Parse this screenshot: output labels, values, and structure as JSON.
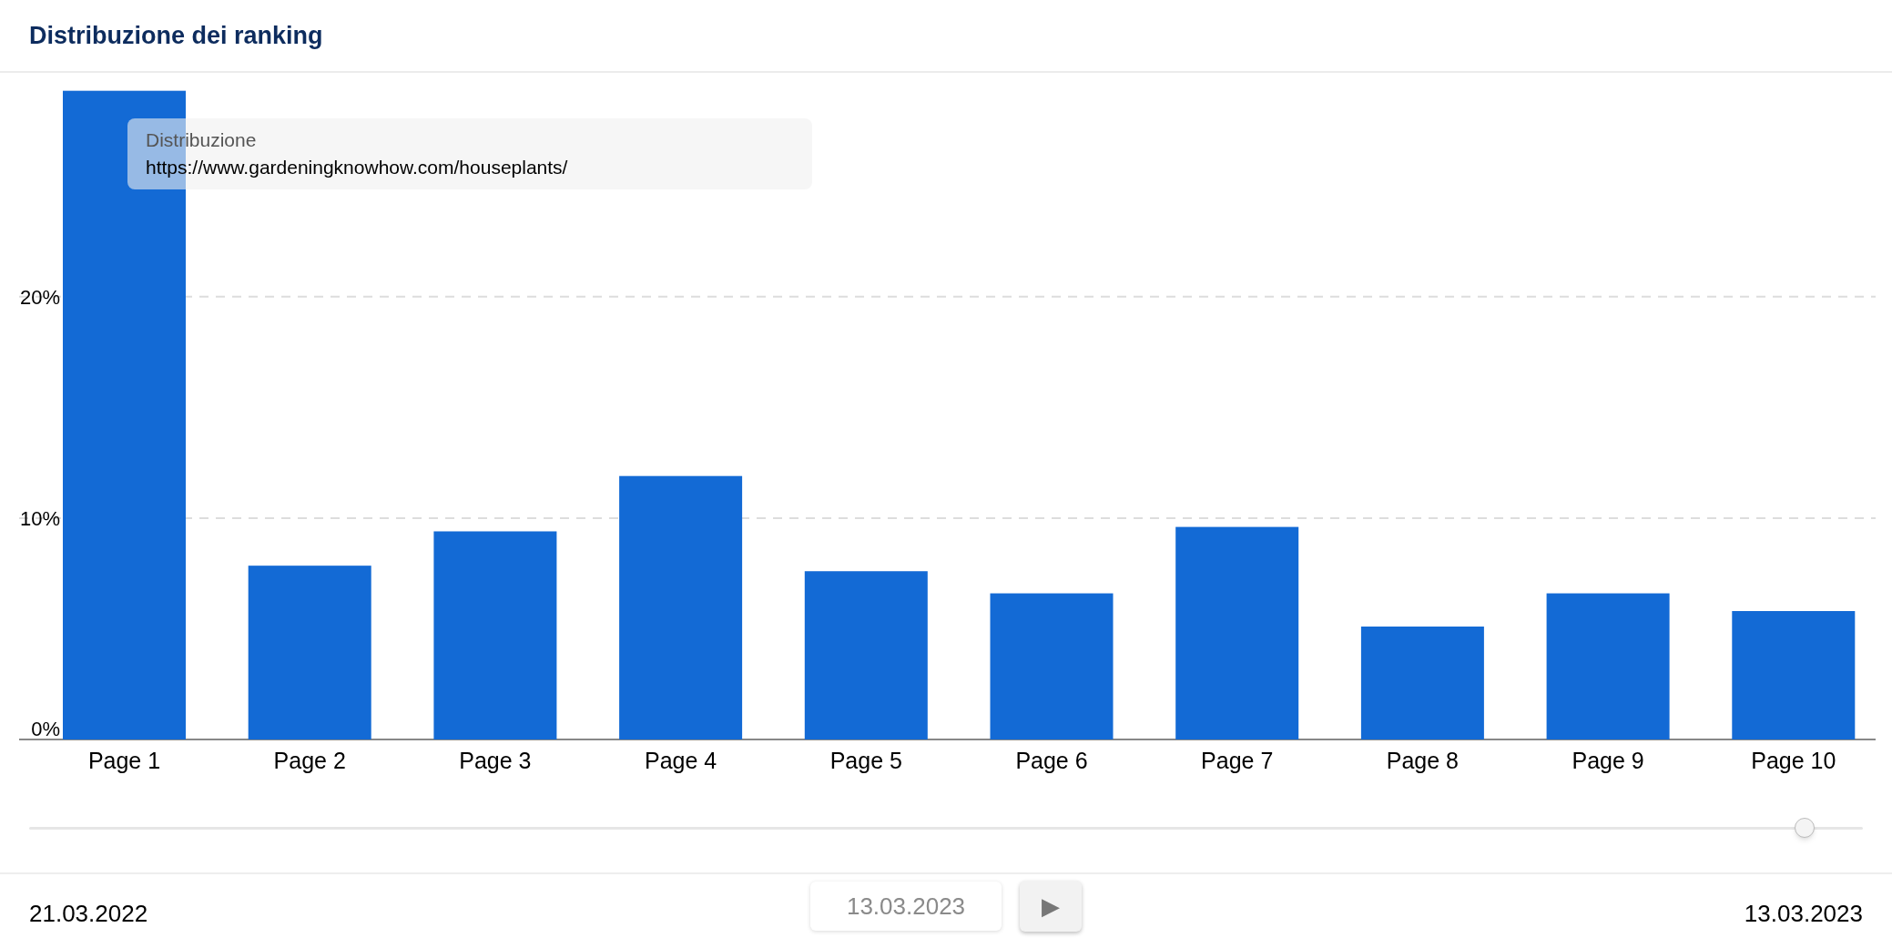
{
  "card": {
    "title": "Distribuzione dei ranking"
  },
  "chart_data": {
    "type": "bar",
    "categories": [
      "Page 1",
      "Page 2",
      "Page 3",
      "Page 4",
      "Page 5",
      "Page 6",
      "Page 7",
      "Page 8",
      "Page 9",
      "Page 10"
    ],
    "series": [
      {
        "name": "Distribuzione",
        "color": "#136ad5",
        "values": [
          29.3,
          7.85,
          9.4,
          11.9,
          7.6,
          6.6,
          9.6,
          5.1,
          6.6,
          5.8
        ]
      }
    ],
    "ylim": [
      0,
      33.4
    ],
    "yticks": [
      {
        "value": 0,
        "label": "0%"
      },
      {
        "value": 10,
        "label": "10%"
      },
      {
        "value": 20,
        "label": "20%"
      }
    ]
  },
  "tooltip": {
    "text": "https://www.gardeningknowhow.com/houseplants/"
  },
  "timeline": {
    "level": 0.968,
    "start_date": "21.03.2022",
    "current_date": "13.03.2023",
    "end_date": "13.03.2023",
    "play_symbol": "▶"
  }
}
